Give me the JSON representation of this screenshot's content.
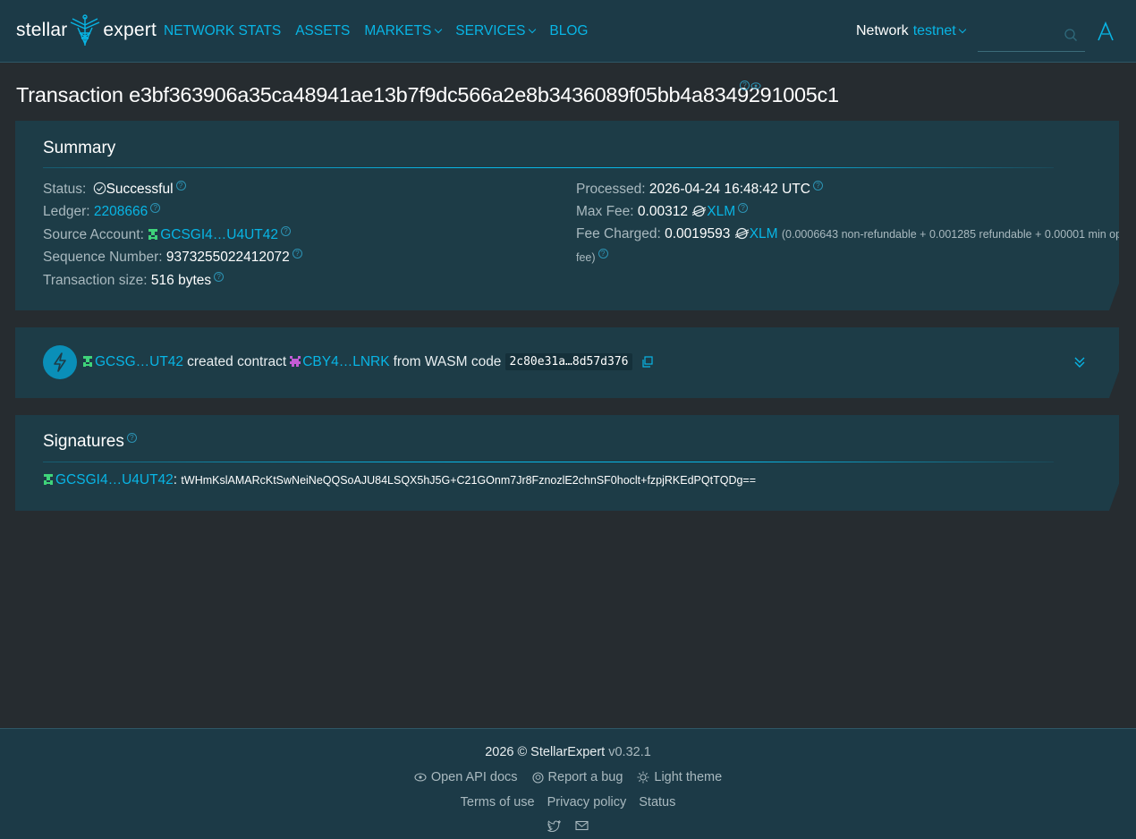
{
  "header": {
    "logo_left": "stellar",
    "logo_right": "expert",
    "nav": [
      {
        "label": "NETWORK STATS",
        "dropdown": false
      },
      {
        "label": "ASSETS",
        "dropdown": false
      },
      {
        "label": "MARKETS",
        "dropdown": true
      },
      {
        "label": "SERVICES",
        "dropdown": true
      },
      {
        "label": "BLOG",
        "dropdown": false
      }
    ],
    "network_label": "Network",
    "network_value": "testnet"
  },
  "page": {
    "title_prefix": "Transaction",
    "hash": "e3bf363906a35ca48941ae13b7f9dc566a2e8b3436089f05bb4a8349291005c1"
  },
  "summary": {
    "title": "Summary",
    "status_label": "Status:",
    "status_value": "Successful",
    "ledger_label": "Ledger:",
    "ledger_value": "2208666",
    "source_label": "Source Account:",
    "source_value": "GCSGI4…U4UT42",
    "sequence_label": "Sequence Number:",
    "sequence_value": "9373255022412072",
    "size_label": "Transaction size:",
    "size_value": "516 bytes",
    "processed_label": "Processed:",
    "processed_value": "2026-04-24 16:48:42 UTC",
    "maxfee_label": "Max Fee:",
    "maxfee_value": "0.00312",
    "maxfee_asset": "XLM",
    "feecharged_label": "Fee Charged:",
    "feecharged_value": "0.0019593",
    "feecharged_asset": "XLM",
    "fee_breakdown": "(0.0006643 non-refundable + 0.001285 refundable + 0.00001 min op",
    "fee_breakdown_end": "fee)"
  },
  "operation": {
    "account": "GCSG…UT42",
    "action": "created contract",
    "contract": "CBY4…LNRK",
    "from_text": "from WASM code",
    "wasm_hash": "2c80e31a…8d57d376"
  },
  "signatures": {
    "title": "Signatures",
    "signer": "GCSGI4…U4UT42",
    "separator": ":",
    "value": "tWHmKslAMARcKtSwNeiNeQQSoAJU84LSQX5hJ5G+C21GOnm7Jr8FznozlE2chnSF0hoclt+fzpjRKEdPQtTQDg=="
  },
  "footer": {
    "year": "2026 © StellarExpert",
    "version": "v0.32.1",
    "api_docs": "Open API docs",
    "report_bug": "Report a bug",
    "light_theme": "Light theme",
    "terms": "Terms of use",
    "privacy": "Privacy policy",
    "status": "Status"
  },
  "colors": {
    "accent": "#08b5e5",
    "background": "#262c30",
    "panel": "#1d3c47",
    "header": "#1c3a47",
    "account_icon": "#3fd37a",
    "contract_icon": "#c35bd6"
  }
}
